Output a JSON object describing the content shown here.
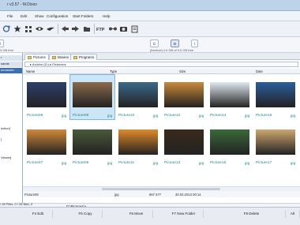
{
  "window": {
    "title": "r v3.57 - M.Dixon"
  },
  "menu": [
    "File",
    "Edit",
    "Show",
    "Configuration",
    "Start Folders",
    "Help"
  ],
  "drives": {
    "left": {
      "label": "\\",
      "info": "3 GB free"
    },
    "right_c": {
      "label": "C"
    },
    "right_d": {
      "label": "D",
      "info": "[Archive] 4.9 GB of 5.0 GB free"
    },
    "right_root": {
      "label": "\\"
    }
  },
  "left_panel": {
    "rows": [
      "r",
      "sands",
      "mmander",
      "",
      "",
      "ection]",
      "]",
      "Viewer]",
      "",
      "",
      ""
    ]
  },
  "right_panel": {
    "tabs": [
      {
        "label": "Pictures"
      },
      {
        "label": "Movies"
      },
      {
        "label": "Programs"
      }
    ],
    "path": "▸ Archive (D:) ▸ Pictures ▸",
    "columns": {
      "name": "Name",
      "type": "Type",
      "size": "Size",
      "date": "Date"
    },
    "files": [
      {
        "name": "Picture06",
        "ext": "jpg",
        "color": "#2d3f6a"
      },
      {
        "name": "Picture08",
        "ext": "jpg",
        "color": "#8a6a4a",
        "selected": true
      },
      {
        "name": "Picture10",
        "ext": "jpg",
        "color": "#3a6a8a"
      },
      {
        "name": "Picture12",
        "ext": "jpg",
        "color": "#c88a3a"
      },
      {
        "name": "Picture14",
        "ext": "jpg",
        "color": "#dfe8f0"
      },
      {
        "name": "Picture16",
        "ext": "jpg",
        "color": "#2a5f9a"
      },
      {
        "name": "Picture07",
        "ext": "jpg",
        "color": "#d08a3a"
      },
      {
        "name": "Picture09",
        "ext": "jpg",
        "color": "#4a5a3a"
      },
      {
        "name": "Picture11",
        "ext": "jpg",
        "color": "#e08a2a"
      },
      {
        "name": "Picture13",
        "ext": "jpg",
        "color": "#3a2a1a"
      },
      {
        "name": "Picture15",
        "ext": "jpg",
        "color": "#3a6a3a"
      },
      {
        "name": "Picture17",
        "ext": "jpg",
        "color": "#d0a870"
      }
    ],
    "status": {
      "name": "Picture08",
      "type": "jpg",
      "size": "867 577",
      "date": "30.04.2013 00:14"
    }
  },
  "command_line": {
    "path": "D:\\Pictures\\>"
  },
  "left_status": "/ 28 Files, 0 / 28 files, 0",
  "fkeys": [
    {
      "label": "F4 Edit"
    },
    {
      "label": "F5 Copy"
    },
    {
      "label": "F6 Move"
    },
    {
      "label": "F7 New Folder"
    },
    {
      "label": "F8 Delete"
    },
    {
      "label": "Alt"
    }
  ]
}
